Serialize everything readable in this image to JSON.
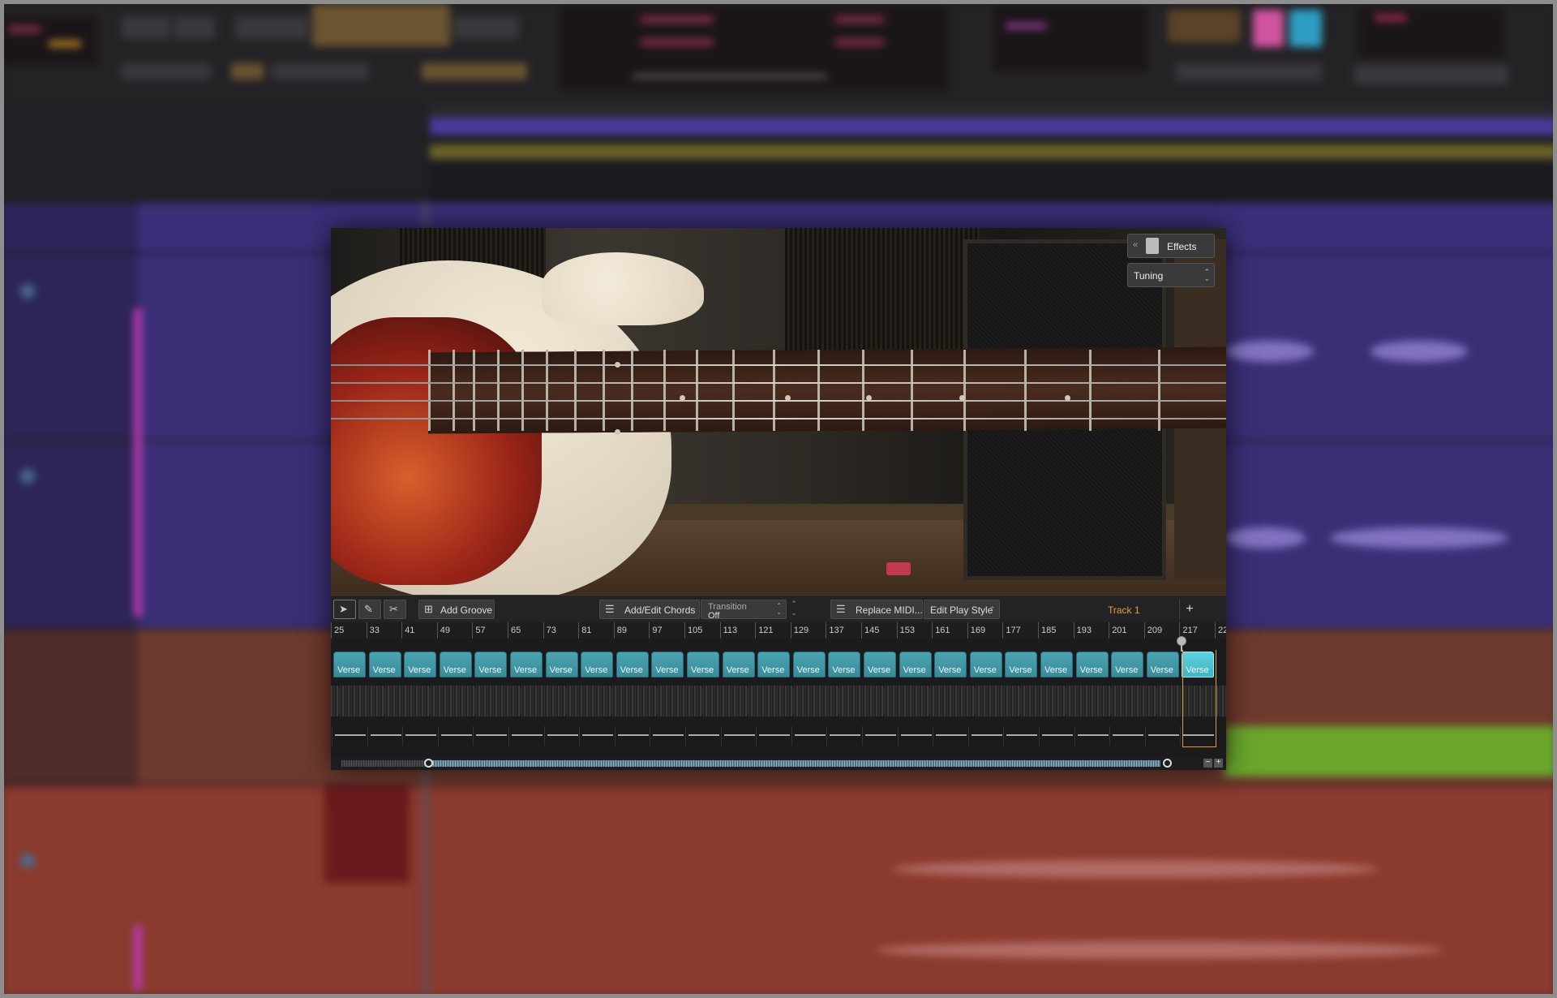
{
  "plugin": {
    "effects_label": "Effects",
    "tuning_label": "Tuning",
    "toolbar": {
      "add_groove": "Add Groove",
      "add_edit_chords": "Add/Edit Chords",
      "transition_title": "Transition",
      "transition_value": "Off",
      "replace_midi": "Replace MIDI...",
      "edit_play_style": "Edit Play Style",
      "track_name": "Track 1",
      "add_track": "+"
    },
    "timeline": {
      "bars": [
        "25",
        "33",
        "41",
        "49",
        "57",
        "65",
        "73",
        "81",
        "89",
        "97",
        "105",
        "113",
        "121",
        "129",
        "137",
        "145",
        "153",
        "161",
        "169",
        "177",
        "185",
        "193",
        "201",
        "209",
        "217",
        "22"
      ],
      "part_label": "Verse",
      "part_count": 25,
      "selected_part_index": 24
    },
    "zoom": {
      "minus": "−",
      "plus": "+"
    }
  },
  "colors": {
    "part": "#4aa4b3",
    "part_selected": "#5fd2e0",
    "track_label": "#e39b3a",
    "background_lane_purple": "#3a2f78",
    "background_lane_red": "#8a3a2e"
  }
}
